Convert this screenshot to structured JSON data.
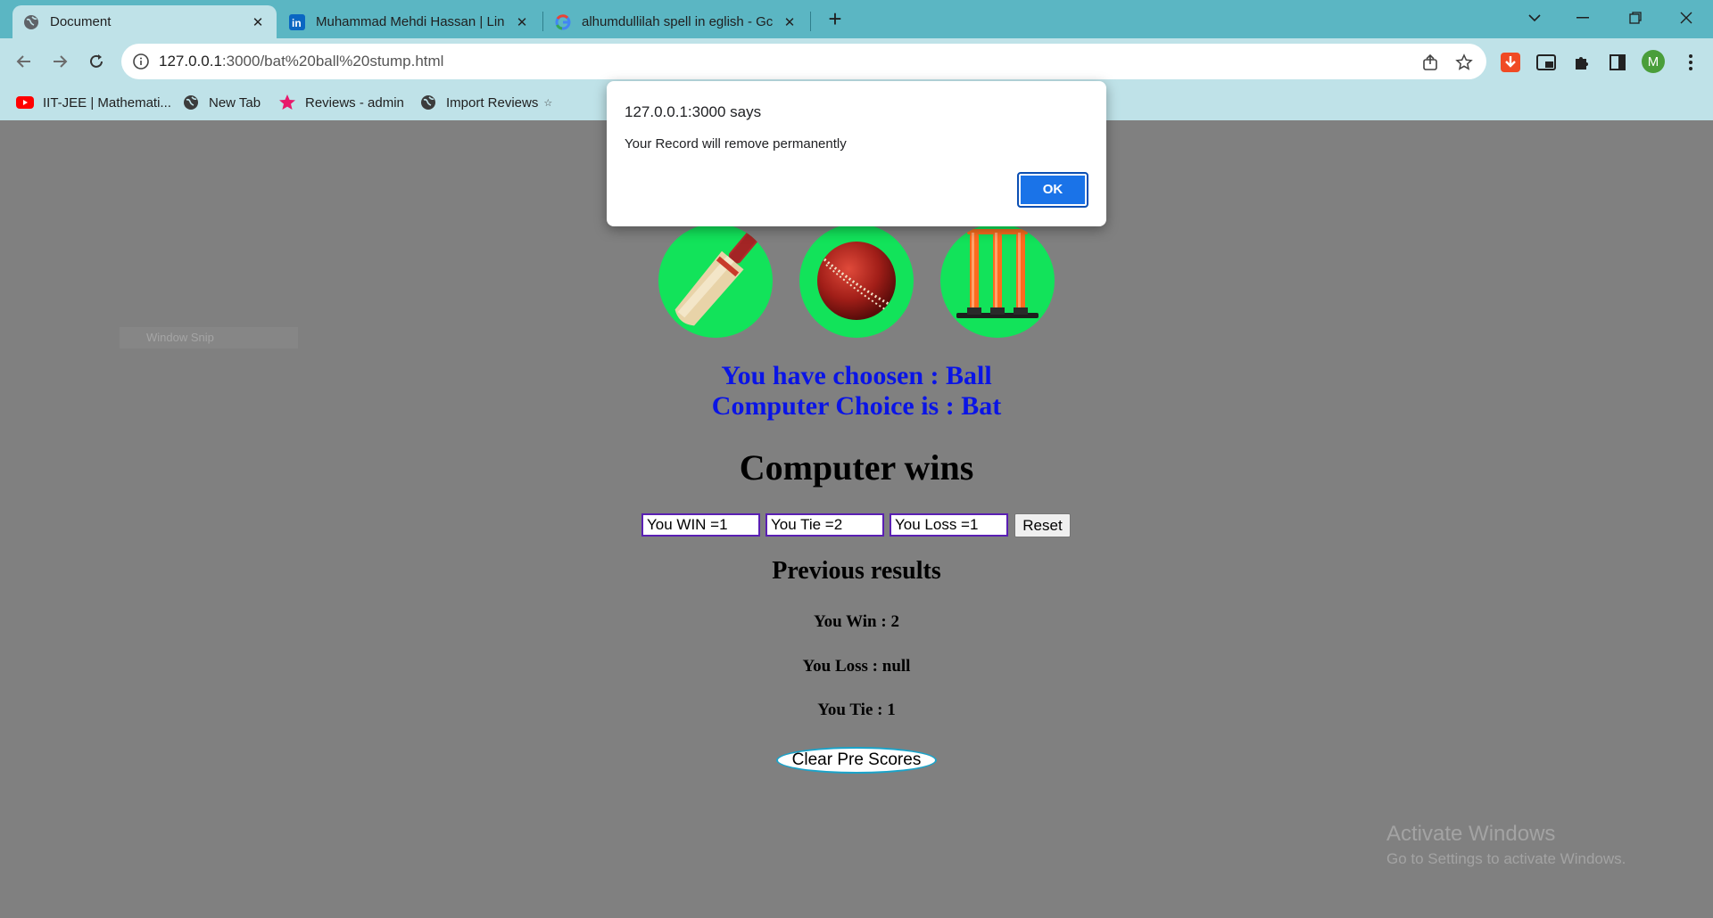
{
  "browser": {
    "tabs": [
      {
        "title": "Document",
        "icon": "globe-icon",
        "active": true
      },
      {
        "title": "Muhammad Mehdi Hassan | Lin",
        "icon": "linkedin-icon",
        "active": false
      },
      {
        "title": "alhumdullilah spell in eglish - Gc",
        "icon": "google-icon",
        "active": false
      }
    ],
    "new_tab_symbol": "+",
    "url_host": "127.0.0.1",
    "url_rest": ":3000/bat%20ball%20stump.html",
    "bookmarks": [
      {
        "label": "IIT-JEE | Mathemati...",
        "icon": "youtube-icon"
      },
      {
        "label": "New Tab",
        "icon": "globe-icon"
      },
      {
        "label": "Reviews - admin",
        "icon": "star-icon"
      },
      {
        "label": "Import Reviews",
        "icon": "globe-icon"
      }
    ],
    "profile_initial": "M",
    "colors": {
      "tabbar": "#5bb6c3",
      "toolbar": "#bfe2e8",
      "ok_button": "#1a73e8"
    }
  },
  "dialog": {
    "title": "127.0.0.1:3000 says",
    "message": "Your Record will remove permanently",
    "ok_label": "OK"
  },
  "game": {
    "choices": [
      {
        "name": "bat",
        "icon": "cricket-bat-icon"
      },
      {
        "name": "ball",
        "icon": "cricket-ball-icon"
      },
      {
        "name": "stump",
        "icon": "stumps-icon"
      }
    ],
    "user_choice_text": "You have choosen : Ball",
    "computer_choice_text": "Computer Choice is : Bat",
    "result_text": "Computer wins",
    "scores": {
      "win": "You WIN =1",
      "tie": "You Tie =2",
      "loss": "You Loss =1"
    },
    "reset_label": "Reset",
    "previous_title": "Previous results",
    "previous": {
      "win": "You Win : 2",
      "loss": "You Loss : null",
      "tie": "You Tie : 1"
    },
    "clear_label": "Clear Pre Scores",
    "colors": {
      "circle": "#12e35a",
      "choice_text": "#0a14e6"
    }
  },
  "ghost_text": "Window Snip",
  "watermark": {
    "title": "Activate Windows",
    "subtitle": "Go to Settings to activate Windows."
  }
}
